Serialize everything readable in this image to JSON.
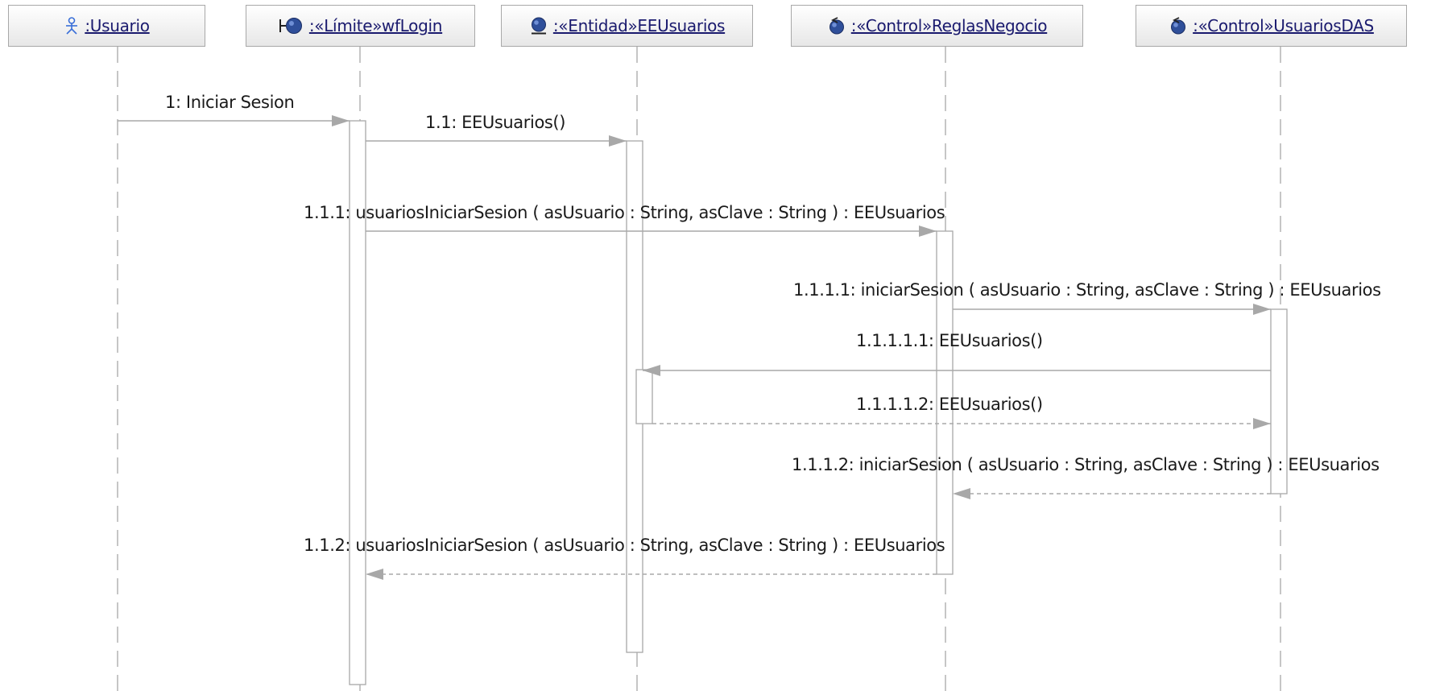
{
  "participants": [
    {
      "id": "usuario",
      "name": ":Usuario",
      "icon": "actor-icon"
    },
    {
      "id": "wflogin",
      "name": ":«Límite»wfLogin",
      "icon": "boundary-icon"
    },
    {
      "id": "eeusuarios",
      "name": ":«Entidad»EEUsuarios",
      "icon": "entity-icon"
    },
    {
      "id": "reglas",
      "name": ":«Control»ReglasNegocio",
      "icon": "control-icon"
    },
    {
      "id": "usuariosdas",
      "name": ":«Control»UsuariosDAS",
      "icon": "control-icon"
    }
  ],
  "messages": [
    {
      "id": "m1",
      "label": "1: Iniciar Sesion",
      "from": "usuario",
      "to": "wflogin",
      "kind": "call"
    },
    {
      "id": "m1_1",
      "label": "1.1: EEUsuarios()",
      "from": "wflogin",
      "to": "eeusuarios",
      "kind": "call"
    },
    {
      "id": "m1_1_1",
      "label": "1.1.1: usuariosIniciarSesion ( asUsuario : String, asClave : String ) : EEUsuarios",
      "from": "wflogin",
      "to": "reglas",
      "kind": "call"
    },
    {
      "id": "m1_1_1_1",
      "label": "1.1.1.1: iniciarSesion ( asUsuario : String, asClave : String ) : EEUsuarios",
      "from": "reglas",
      "to": "usuariosdas",
      "kind": "call"
    },
    {
      "id": "m1_1_1_1_1",
      "label": "1.1.1.1.1: EEUsuarios()",
      "from": "usuariosdas",
      "to": "eeusuarios",
      "kind": "call"
    },
    {
      "id": "m1_1_1_1_2",
      "label": "1.1.1.1.2: EEUsuarios()",
      "from": "eeusuarios",
      "to": "usuariosdas",
      "kind": "return"
    },
    {
      "id": "m1_1_1_2",
      "label": "1.1.1.2: iniciarSesion ( asUsuario : String, asClave : String ) : EEUsuarios",
      "from": "usuariosdas",
      "to": "reglas",
      "kind": "return"
    },
    {
      "id": "m1_1_2",
      "label": "1.1.2: usuariosIniciarSesion ( asUsuario : String, asClave : String ) : EEUsuarios",
      "from": "reglas",
      "to": "wflogin",
      "kind": "return"
    }
  ],
  "colors": {
    "line": "#a8a8a8",
    "text": "#1a1a1a",
    "name": "#1a1a6e",
    "icon_blue": "#2f4f9a",
    "actor": "#3a6fd8"
  }
}
